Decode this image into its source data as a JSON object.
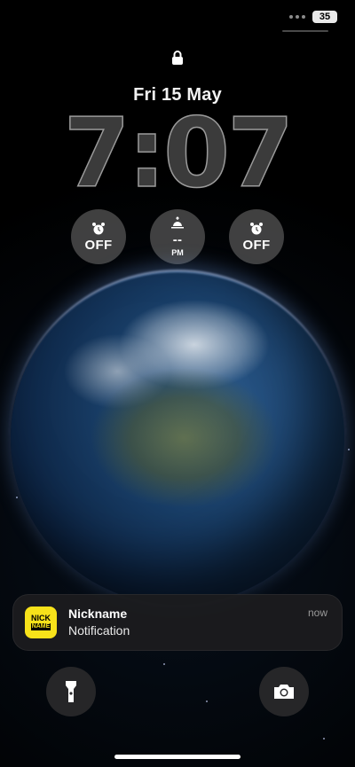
{
  "status_bar": {
    "battery": "35"
  },
  "lock_screen": {
    "date": "Fri 15 May",
    "time": "7:07"
  },
  "widgets": [
    {
      "icon": "alarm-clock-icon",
      "value": "OFF",
      "sub": ""
    },
    {
      "icon": "sunrise-icon",
      "value": "--",
      "sub": "PM"
    },
    {
      "icon": "alarm-clock-icon",
      "value": "OFF",
      "sub": ""
    }
  ],
  "notification": {
    "app_icon_text_top": "NICK",
    "app_icon_text_bottom": "NAME",
    "title": "Nickname",
    "body": "Notification",
    "time": "now"
  },
  "bottom_controls": {
    "left": "flashlight-icon",
    "right": "camera-icon"
  }
}
